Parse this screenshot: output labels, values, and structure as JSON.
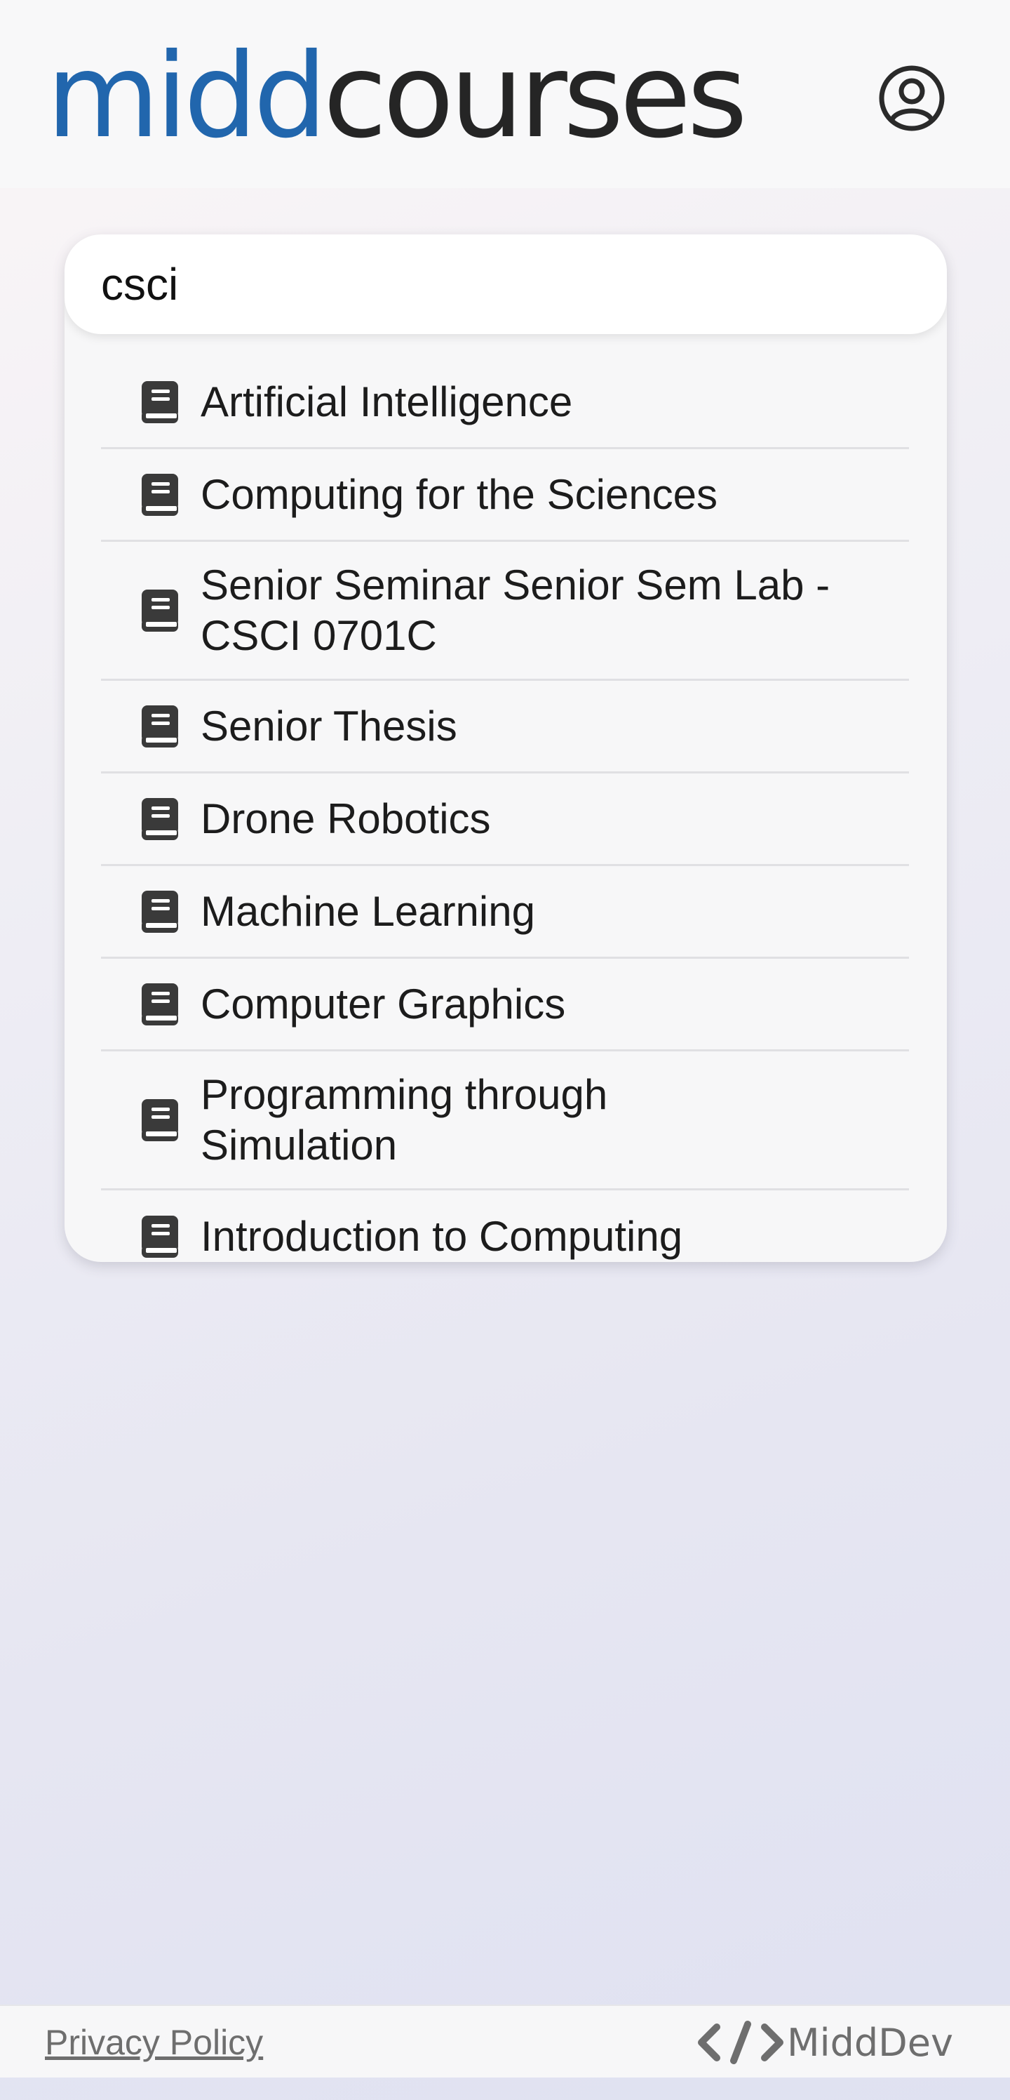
{
  "header": {
    "logo_part1": "midd",
    "logo_part2": "courses",
    "profile_icon": "user-circle-icon",
    "brand_color": "#2166ad"
  },
  "search": {
    "value": "csci",
    "placeholder": ""
  },
  "results": [
    {
      "label": "Artificial Intelligence",
      "icon": "book-icon"
    },
    {
      "label": "Computing for the Sciences",
      "icon": "book-icon"
    },
    {
      "label": "Senior Seminar Senior Sem Lab - CSCI 0701C",
      "icon": "book-icon"
    },
    {
      "label": "Senior Thesis",
      "icon": "book-icon"
    },
    {
      "label": "Drone Robotics",
      "icon": "book-icon"
    },
    {
      "label": "Machine Learning",
      "icon": "book-icon"
    },
    {
      "label": "Computer Graphics",
      "icon": "book-icon"
    },
    {
      "label": "Programming through Simulation",
      "icon": "book-icon"
    },
    {
      "label": "Introduction to Computing",
      "icon": "book-icon"
    }
  ],
  "footer": {
    "privacy_link": "Privacy Policy",
    "middev_label": "MiddDev",
    "middev_icon": "code-icon"
  }
}
